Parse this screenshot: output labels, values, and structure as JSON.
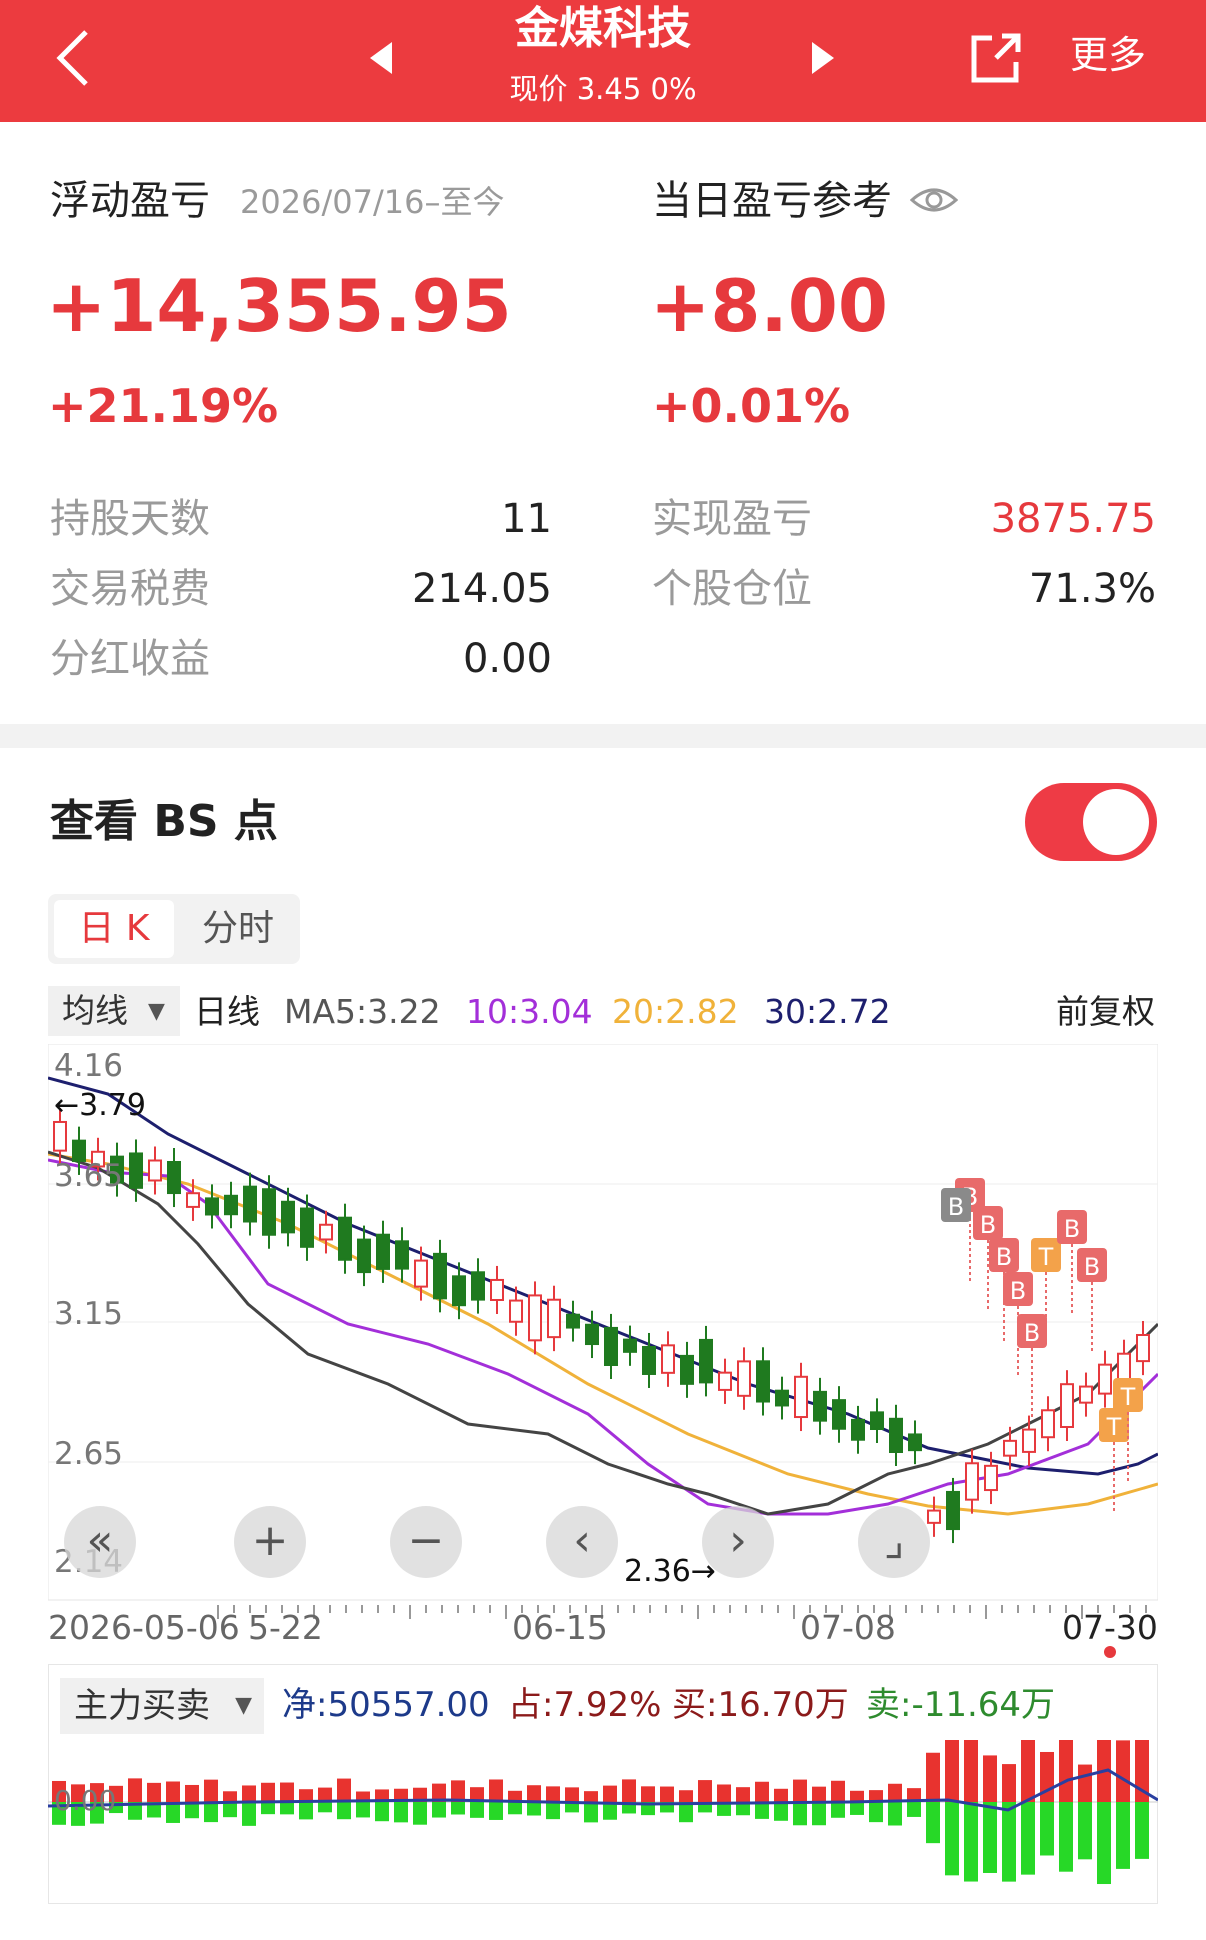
{
  "header": {
    "title": "金煤科技",
    "subtitle": "现价 3.45 0%",
    "more_label": "更多"
  },
  "summary": {
    "floating_label": "浮动盈亏",
    "date_range": "2026/07/16–至今",
    "floating_value": "+14,355.95",
    "floating_pct": "+21.19%",
    "today_label": "当日盈亏参考",
    "today_value": "+8.00",
    "today_pct": "+0.01%"
  },
  "stats": {
    "hold_days_label": "持股天数",
    "hold_days": "11",
    "fee_label": "交易税费",
    "fee": "214.05",
    "dividend_label": "分红收益",
    "dividend": "0.00",
    "realized_label": "实现盈亏",
    "realized": "3875.75",
    "position_label": "个股仓位",
    "position": "71.3%"
  },
  "bs": {
    "title": "查看 BS 点",
    "toggle_on": true,
    "tab_day": "日 K",
    "tab_time": "分时"
  },
  "chart": {
    "ma_select": "均线",
    "period": "日线",
    "ma5": "MA5:3.22",
    "ma10": "10:3.04",
    "ma20": "20:2.82",
    "ma30": "30:2.72",
    "adjust": "前复权",
    "y_top": "4.16",
    "y_mid1": "3.65",
    "y_mid2": "3.15",
    "y_mid3": "2.65",
    "y_bottom": "2.14",
    "high_marker": "←3.79",
    "low_marker": "2.36→",
    "x_start": "2026-05-06",
    "x_2": "5-22",
    "x_3": "06-15",
    "x_4": "07-08",
    "x_end": "07-30",
    "colors": {
      "up": "#e6393d",
      "down": "#1f7a1f",
      "ma5": "#444444",
      "ma10": "#a32fd9",
      "ma20": "#f0b23a",
      "ma30": "#1d1f6e"
    }
  },
  "flow": {
    "select": "主力买卖",
    "net": "净:50557.00",
    "ratio": "占:7.92%",
    "buy": "买:16.70万",
    "sell": "卖:-11.64万",
    "zero": "0.00"
  },
  "chart_data": {
    "type": "candlestick",
    "x_labels": [
      "2026-05-06",
      "5-22",
      "06-15",
      "07-08",
      "07-30"
    ],
    "ylim": [
      2.14,
      4.16
    ],
    "y_ticks": [
      4.16,
      3.65,
      3.15,
      2.65,
      2.14
    ],
    "ma_values": {
      "MA5": 3.22,
      "MA10": 3.04,
      "MA20": 2.82,
      "MA30": 2.72
    },
    "max": 3.79,
    "min": 2.36,
    "markers": [
      "B",
      "B",
      "B",
      "B",
      "B",
      "T",
      "B",
      "B",
      "T",
      "T"
    ]
  }
}
